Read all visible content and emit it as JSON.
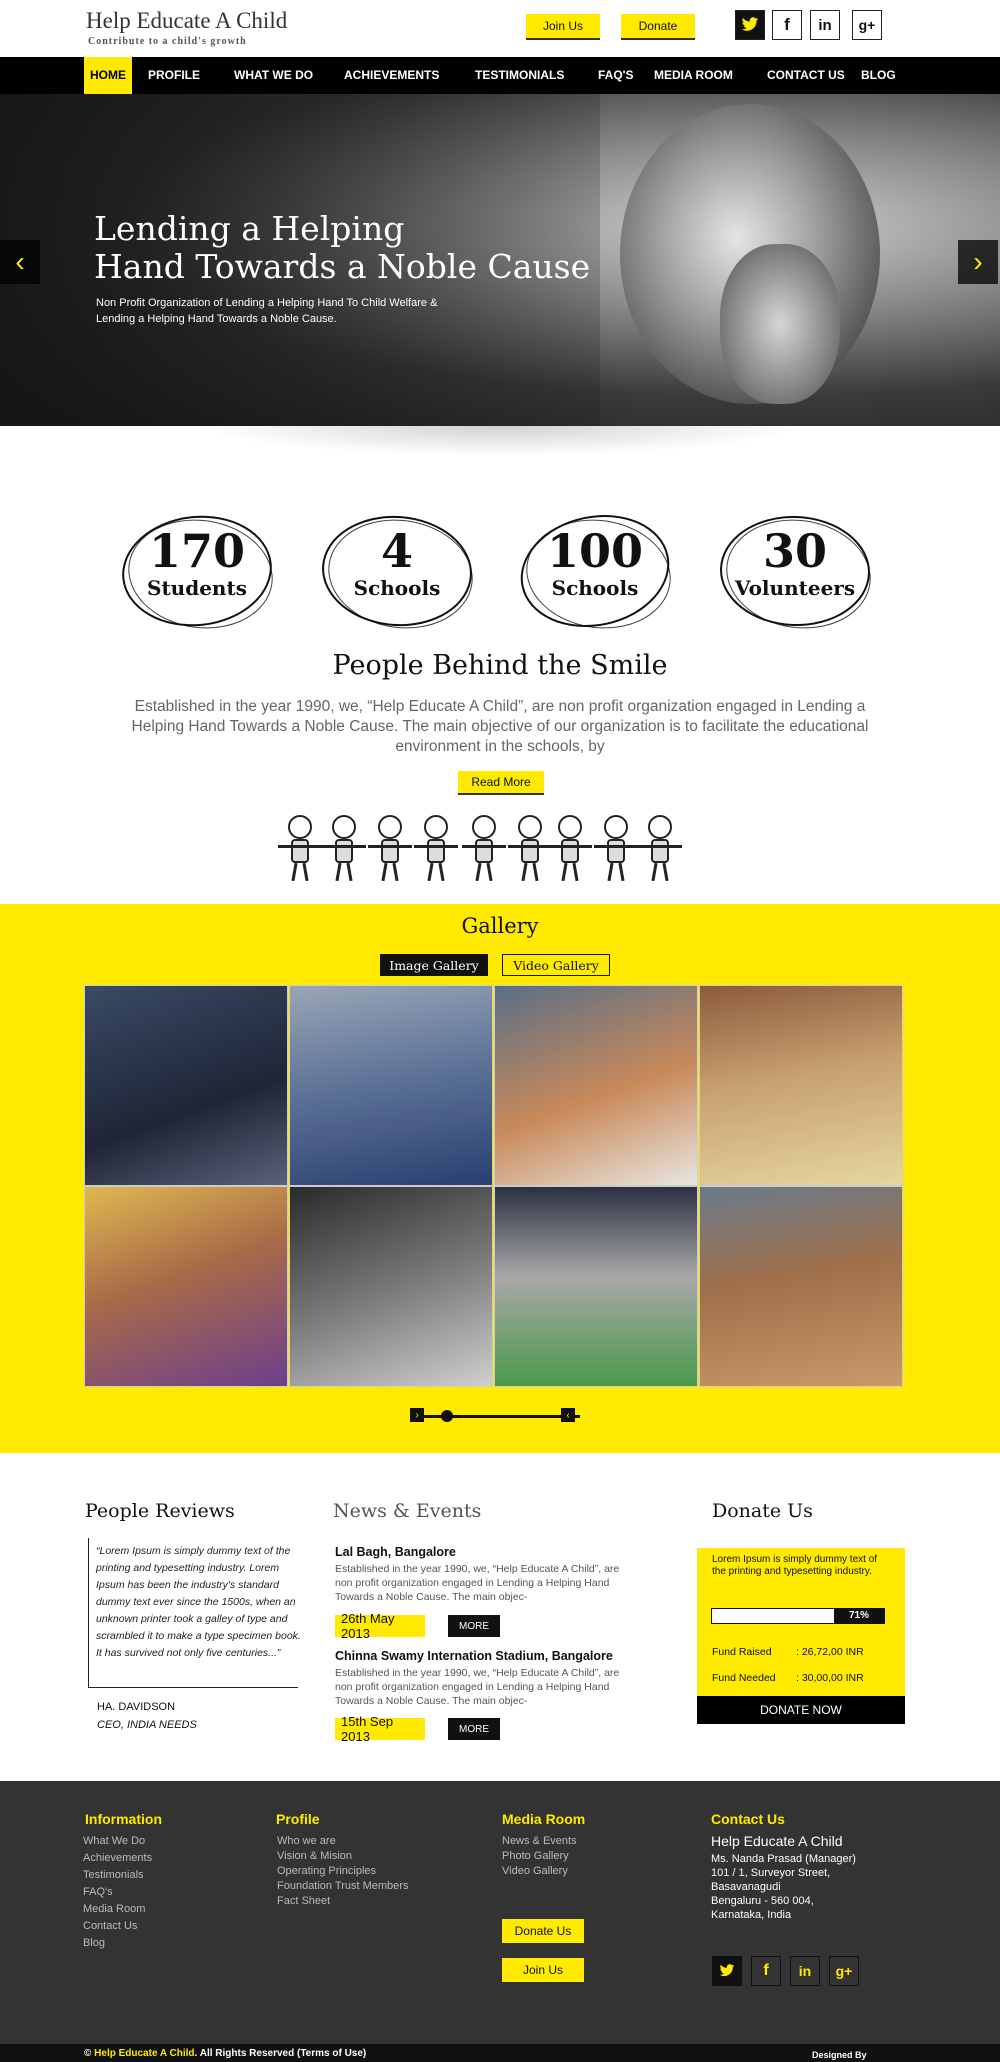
{
  "header": {
    "logo_title": "Help Educate A Child",
    "logo_tagline": "Contribute to a child's growth",
    "join_label": "Join Us",
    "donate_label": "Donate",
    "social": {
      "twitter": "t",
      "facebook": "f",
      "linkedin": "in",
      "google": "g+"
    }
  },
  "nav": {
    "items": [
      "HOME",
      "PROFILE",
      "WHAT WE DO",
      "ACHIEVEMENTS",
      "TESTIMONIALS",
      "FAQ'S",
      "MEDIA ROOM",
      "CONTACT US",
      "BLOG"
    ]
  },
  "hero": {
    "title_line1": "Lending a Helping",
    "title_line2": "Hand Towards a Noble Cause",
    "subtitle": "Non Profit Organization of Lending a Helping Hand To Child Welfare & Lending a Helping Hand Towards a Noble Cause.",
    "prev_icon": "‹",
    "next_icon": "›"
  },
  "stats": [
    {
      "number": "170",
      "label": "Students"
    },
    {
      "number": "4",
      "label": "Schools"
    },
    {
      "number": "100",
      "label": "Schools"
    },
    {
      "number": "30",
      "label": "Volunteers"
    }
  ],
  "about": {
    "title": "People Behind the Smile",
    "text": "Established in the year 1990, we, “Help Educate A Child”, are non profit organization engaged in Lending a Helping Hand Towards a Noble Cause. The main objective of our organization is to facilitate the educational environment in the schools, by",
    "read_more": "Read More"
  },
  "gallery": {
    "title": "Gallery",
    "tab_image": "Image Gallery",
    "tab_video": "Video Gallery",
    "slider_prev": "›",
    "slider_next": "‹"
  },
  "reviews": {
    "title": "People Reviews",
    "quote": "“Lorem Ipsum is simply dummy text of the printing and typesetting industry. Lorem Ipsum has been the industry's standard dummy text ever since the 1500s, when an unknown printer took a galley of type and scrambled it to make a type specimen book. It has survived not only five centuries...”",
    "name": "HA. DAVIDSON",
    "role": "CEO, INDIA NEEDS"
  },
  "news": {
    "title": "News & Events",
    "items": [
      {
        "title": "Lal Bagh, Bangalore",
        "body": "Established in the year 1990, we, “Help Educate A Child”, are non profit organization engaged in Lending a Helping Hand Towards a Noble Cause. The main objec-",
        "date": "26th May 2013",
        "more": "MORE"
      },
      {
        "title": "Chinna Swamy Internation Stadium, Bangalore",
        "body": "Established in the year 1990, we, “Help Educate A Child”, are non profit organization engaged in Lending a Helping Hand Towards a Noble Cause. The main objec-",
        "date": "15th Sep 2013",
        "more": "MORE"
      }
    ]
  },
  "donate": {
    "title": "Donate Us",
    "text": "Lorem Ipsum is simply dummy text of the printing and typesetting industry.",
    "progress_percent": 71,
    "progress_label": "71%",
    "fund_raised_label": "Fund Raised",
    "fund_raised_value": ": 26,72,00 INR",
    "fund_needed_label": "Fund Needed",
    "fund_needed_value": ": 30,00,00 INR",
    "button": "DONATE NOW"
  },
  "footer": {
    "information": {
      "title": "Information",
      "links": [
        "What We Do",
        "Achievements",
        "Testimonials",
        "FAQ's",
        "Media Room",
        "Contact Us",
        "Blog"
      ]
    },
    "profile": {
      "title": "Profile",
      "links": [
        "Who we are",
        "Vision & Mision",
        "Operating Principles",
        "Foundation Trust Members",
        "Fact Sheet"
      ]
    },
    "media": {
      "title": "Media Room",
      "links": [
        "News & Events",
        "Photo Gallery",
        "Video Gallery"
      ],
      "donate_btn": "Donate Us",
      "join_btn": "Join Us"
    },
    "contact": {
      "title": "Contact Us",
      "org": "Help Educate A Child",
      "lines": [
        "Ms. Nanda Prasad (Manager)",
        "101 / 1, Surveyor Street,",
        "Basavanagudi",
        "Bengaluru - 560 004,",
        "Karnataka, India"
      ]
    },
    "copyright_prefix": "© ",
    "copyright_brand": "Help Educate A Child",
    "copyright_suffix": ". All Rights Reserved (Terms of Use)",
    "designed_by": "Designed By"
  },
  "colors": {
    "accent": "#ffea00",
    "dark": "#111111",
    "footer": "#333333"
  }
}
